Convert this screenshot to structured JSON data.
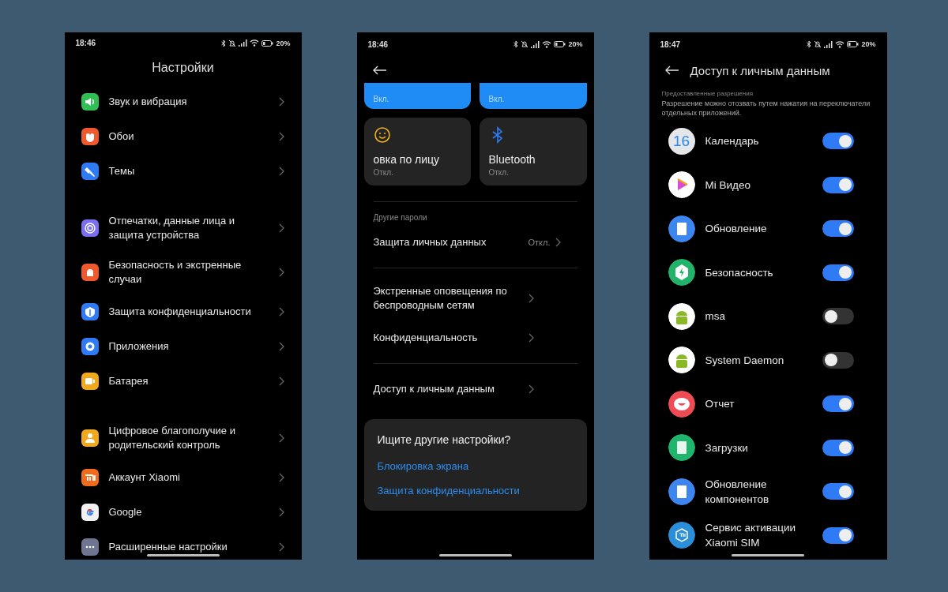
{
  "settings_screen": {
    "status": {
      "time": "18:46",
      "battery": "20%"
    },
    "title": "Настройки",
    "groups": [
      {
        "items": [
          {
            "label": "Звук и вибрация",
            "color": "#2fbf55"
          },
          {
            "label": "Обои",
            "color": "#f0582e"
          },
          {
            "label": "Темы",
            "color": "#2f7bf5"
          }
        ]
      },
      {
        "items": [
          {
            "label": "Отпечатки, данные лица и защита устройства",
            "color": "#7b6ef0"
          },
          {
            "label": "Безопасность и экстренные случаи",
            "color": "#f0582e"
          },
          {
            "label": "Защита конфиденциальности",
            "color": "#2f7bf5"
          },
          {
            "label": "Приложения",
            "color": "#2f7bf5"
          },
          {
            "label": "Батарея",
            "color": "#f0a81c"
          }
        ]
      },
      {
        "items": [
          {
            "label": "Цифровое благополучие и родительский контроль",
            "color": "#f0a81c"
          },
          {
            "label": "Аккаунт Xiaomi",
            "color": "#f26a1b"
          },
          {
            "label": "Google",
            "color": "#f1f1f1"
          },
          {
            "label": "Расширенные настройки",
            "color": "#6f7590"
          }
        ]
      }
    ]
  },
  "passwords_screen": {
    "status": {
      "time": "18:46",
      "battery": "20%"
    },
    "tiles": [
      {
        "state": "Вкл.",
        "on": true
      },
      {
        "state": "Вкл.",
        "on": true
      },
      {
        "title": "овка по лицу",
        "state": "Откл.",
        "on": false
      },
      {
        "title": "Bluetooth",
        "state": "Откл.",
        "on": false
      }
    ],
    "sections": [
      {
        "header": "Другие пароли",
        "items": [
          {
            "label": "Защита личных данных",
            "value": "Откл."
          }
        ]
      },
      {
        "items": [
          {
            "label": "Экстренные оповещения по беспроводным сетям"
          },
          {
            "label": "Конфиденциальность"
          }
        ]
      },
      {
        "items": [
          {
            "label": "Доступ к личным данным"
          }
        ]
      }
    ],
    "suggest_card": {
      "title": "Ищите другие настройки?",
      "links": [
        "Блокировка экрана",
        "Защита конфиденциальности"
      ]
    }
  },
  "access_screen": {
    "status": {
      "time": "18:47",
      "battery": "20%"
    },
    "title": "Доступ к личным данным",
    "caption": "Предоставленные разрешения",
    "description": "Разрешение можно отозвать путем нажатия на переключатели отдельных приложений.",
    "apps": [
      {
        "name": "Календарь",
        "color": "#e4e6ea",
        "badge": "16",
        "on": true
      },
      {
        "name": "Mi Видео",
        "color": "#ffffff",
        "on": true
      },
      {
        "name": "Обновление",
        "color": "#3d86f0",
        "on": true
      },
      {
        "name": "Безопасность",
        "color": "#22b36a",
        "on": true
      },
      {
        "name": "msa",
        "color": "#ffffff",
        "on": false
      },
      {
        "name": "System Daemon",
        "color": "#ffffff",
        "on": false
      },
      {
        "name": "Отчет",
        "color": "#ee4b55",
        "on": true
      },
      {
        "name": "Загрузки",
        "color": "#1fb56c",
        "on": true
      },
      {
        "name": "Обновление компонентов",
        "color": "#3d86f0",
        "on": true
      },
      {
        "name": "Сервис активации Xiaomi SIM",
        "color": "#2a8fd8",
        "on": true
      }
    ]
  }
}
